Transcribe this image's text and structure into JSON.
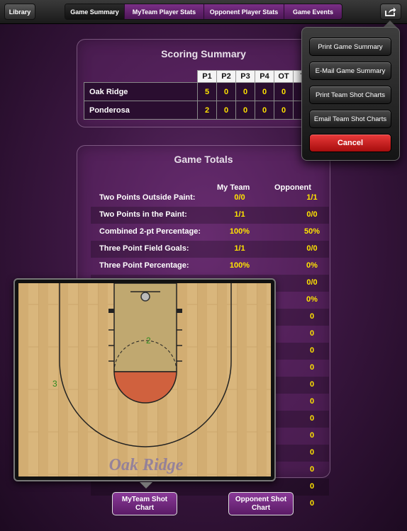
{
  "topbar": {
    "library_label": "Library",
    "tabs": [
      {
        "label": "Game Summary",
        "active": true
      },
      {
        "label": "MyTeam Player Stats",
        "active": false
      },
      {
        "label": "Opponent Player Stats",
        "active": false
      },
      {
        "label": "Game Events",
        "active": false
      }
    ],
    "share_icon": "share-icon"
  },
  "scoring_summary": {
    "title": "Scoring Summary",
    "columns": [
      "P1",
      "P2",
      "P3",
      "P4",
      "OT",
      "T"
    ],
    "rows": [
      {
        "team": "Oak Ridge",
        "scores": [
          "5",
          "0",
          "0",
          "0",
          "0"
        ]
      },
      {
        "team": "Ponderosa",
        "scores": [
          "2",
          "0",
          "0",
          "0",
          "0"
        ]
      }
    ]
  },
  "game_totals": {
    "title": "Game Totals",
    "col_my_team": "My Team",
    "col_opponent": "Opponent",
    "rows": [
      {
        "label": "Two Points Outside Paint:",
        "my": "0/0",
        "opp": "1/1"
      },
      {
        "label": "Two Points in the Paint:",
        "my": "1/1",
        "opp": "0/0"
      },
      {
        "label": "Combined 2-pt Percentage:",
        "my": "100%",
        "opp": "50%"
      },
      {
        "label": "Three Point Field Goals:",
        "my": "1/1",
        "opp": "0/0"
      },
      {
        "label": "Three Point Percentage:",
        "my": "100%",
        "opp": "0%"
      },
      {
        "label": "",
        "my": "",
        "opp": "0/0"
      },
      {
        "label": "",
        "my": "",
        "opp": "0%"
      },
      {
        "label": "",
        "my": "",
        "opp": "0"
      },
      {
        "label": "",
        "my": "",
        "opp": "0"
      },
      {
        "label": "",
        "my": "",
        "opp": "0"
      },
      {
        "label": "",
        "my": "",
        "opp": "0"
      },
      {
        "label": "",
        "my": "",
        "opp": "0"
      },
      {
        "label": "",
        "my": "",
        "opp": "0"
      },
      {
        "label": "",
        "my": "",
        "opp": "0"
      },
      {
        "label": "",
        "my": "",
        "opp": "0"
      },
      {
        "label": "",
        "my": "",
        "opp": "0"
      },
      {
        "label": "",
        "my": "",
        "opp": "0"
      },
      {
        "label": "",
        "my": "",
        "opp": "0"
      },
      {
        "label": "",
        "my": "",
        "opp": "0"
      }
    ]
  },
  "shot_chart": {
    "team_name": "Oak Ridge",
    "markers": [
      {
        "label": "2",
        "color": "#2e8a1e"
      },
      {
        "label": "3",
        "color": "#2e8a1e"
      }
    ],
    "colors": {
      "floor": "#d8b47a",
      "paint": "#c0a870",
      "restricted": "#d0613e"
    }
  },
  "share_menu": {
    "items": [
      "Print Game Summary",
      "E-Mail Game Summary",
      "Print Team Shot Charts",
      "Email Team Shot Charts"
    ],
    "cancel_label": "Cancel"
  },
  "bottom": {
    "myteam_chart_label": "MyTeam Shot Chart",
    "opponent_chart_label": "Opponent Shot Chart"
  }
}
